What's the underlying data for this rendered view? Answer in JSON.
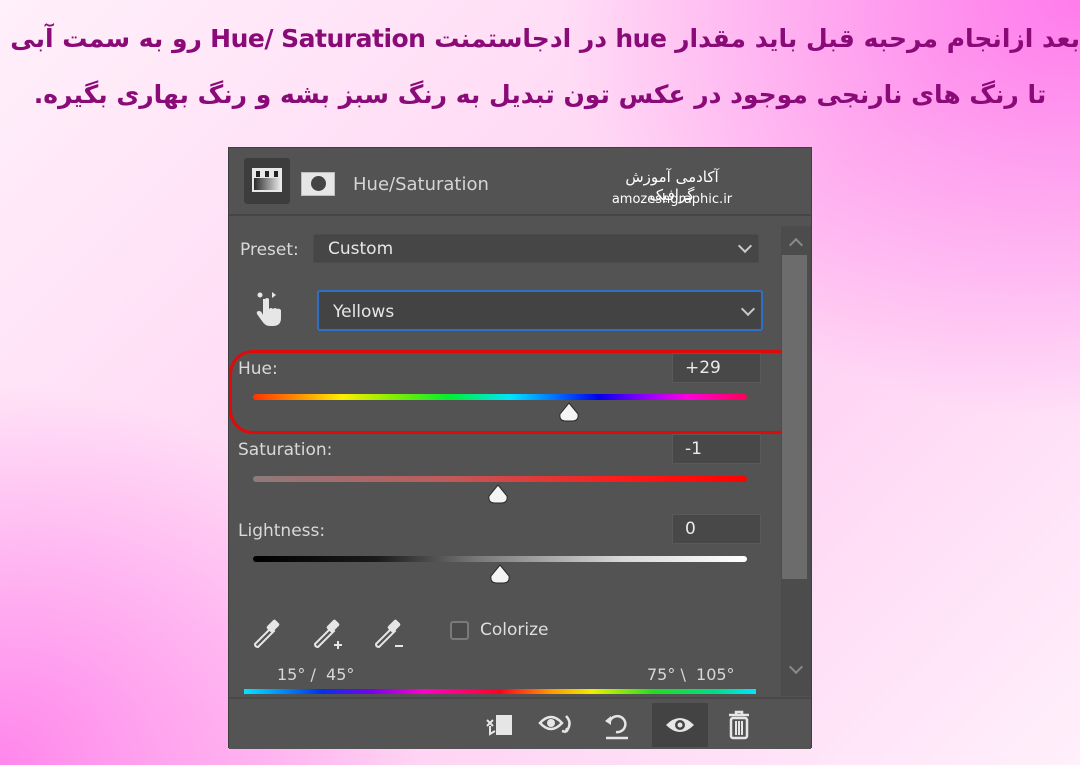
{
  "caption": {
    "line1": "بعد ازانجام مرحبه قبل باید مقدار hue در ادجاستمنت Hue/ Saturation رو به سمت آبی ببریم",
    "line2": "تا رنگ های نارنجی موجود در عکس تون تبدیل به رنگ سبز بشه و رنگ بهاری بگیره."
  },
  "panel": {
    "header": {
      "title": "Hue/Saturation",
      "icons": [
        "adjustment-layer-icon",
        "layer-mask-icon"
      ],
      "watermark_fa": "آکادمی آموزش گرافیک",
      "watermark_en": "amozeshgraphic.ir"
    },
    "preset": {
      "label": "Preset:",
      "value": "Custom"
    },
    "channel": {
      "value": "Yellows",
      "tool_icon": "targeted-adjustment-hand-icon"
    },
    "hue": {
      "label": "Hue:",
      "value": "+29",
      "fraction": 0.64
    },
    "saturation": {
      "label": "Saturation:",
      "value": "-1",
      "fraction": 0.495
    },
    "lightness": {
      "label": "Lightness:",
      "value": "0",
      "fraction": 0.5
    },
    "eyedroppers": [
      "eyedropper-icon",
      "eyedropper-add-icon",
      "eyedropper-subtract-icon"
    ],
    "colorize": {
      "label": "Colorize",
      "checked": false
    },
    "range": {
      "left": "15° /  45°",
      "right": "75° \\  105°"
    },
    "footer": {
      "buttons": [
        "clip-to-layer-icon",
        "view-previous-state-icon",
        "reset-icon",
        "visibility-eye-icon",
        "trash-icon"
      ],
      "active_index": 3
    },
    "highlight_color": "#e00a0a",
    "accent_blue": "#2f6fc6"
  }
}
